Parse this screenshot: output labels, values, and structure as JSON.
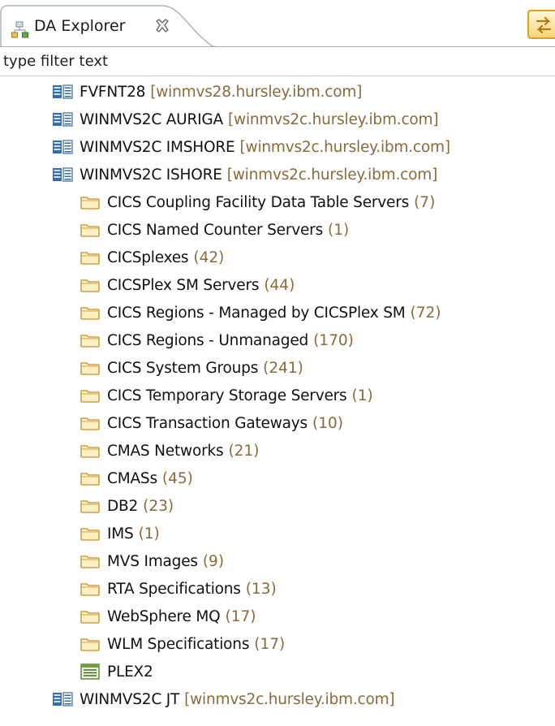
{
  "view": {
    "tab_title": "DA Explorer",
    "tab_icon": "hierarchy-icon",
    "close_icon": "close-icon",
    "toolbar_icon": "link-with-editor-icon"
  },
  "filter": {
    "placeholder": "type filter text",
    "value": ""
  },
  "tree": {
    "systems": [
      {
        "name": "FVFNT28",
        "host": "[winmvs28.hursley.ibm.com]"
      },
      {
        "name": "WINMVS2C AURIGA",
        "host": "[winmvs2c.hursley.ibm.com]"
      },
      {
        "name": "WINMVS2C IMSHORE",
        "host": "[winmvs2c.hursley.ibm.com]"
      },
      {
        "name": "WINMVS2C ISHORE",
        "host": "[winmvs2c.hursley.ibm.com]"
      }
    ],
    "folders": [
      {
        "label": "CICS Coupling Facility Data Table Servers",
        "count": "(7)"
      },
      {
        "label": "CICS Named Counter Servers",
        "count": "(1)"
      },
      {
        "label": "CICSplexes",
        "count": "(42)"
      },
      {
        "label": "CICSPlex SM Servers",
        "count": "(44)"
      },
      {
        "label": "CICS Regions - Managed by CICSPlex SM",
        "count": "(72)"
      },
      {
        "label": "CICS Regions - Unmanaged",
        "count": "(170)"
      },
      {
        "label": "CICS System Groups",
        "count": "(241)"
      },
      {
        "label": "CICS Temporary Storage Servers",
        "count": "(1)"
      },
      {
        "label": "CICS Transaction Gateways",
        "count": "(10)"
      },
      {
        "label": "CMAS Networks",
        "count": "(21)"
      },
      {
        "label": "CMASs",
        "count": "(45)"
      },
      {
        "label": "DB2",
        "count": "(23)"
      },
      {
        "label": "IMS",
        "count": "(1)"
      },
      {
        "label": "MVS Images",
        "count": "(9)"
      },
      {
        "label": "RTA Specifications",
        "count": "(13)"
      },
      {
        "label": "WebSphere MQ",
        "count": "(17)"
      },
      {
        "label": "WLM Specifications",
        "count": "(17)"
      }
    ],
    "plex": {
      "label": "PLEX2"
    },
    "last_system": {
      "name": "WINMVS2C JT",
      "host": "[winmvs2c.hursley.ibm.com]"
    }
  },
  "colors": {
    "count_text": "#8a6a3a",
    "folder_outline": "#c8a24a",
    "folder_fill": "#fdf1c4",
    "system_icon_blue": "#3a6fb0"
  }
}
